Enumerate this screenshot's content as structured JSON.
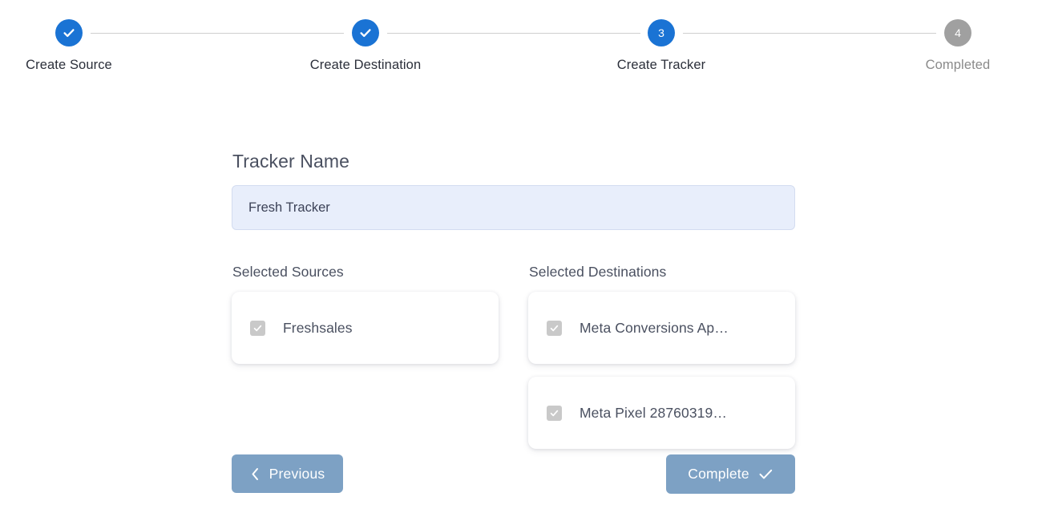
{
  "stepper": {
    "steps": [
      {
        "label": "Create Source",
        "marker": "check",
        "state": "done",
        "center": 86
      },
      {
        "label": "Create Destination",
        "marker": "check",
        "state": "done",
        "center": 456
      },
      {
        "label": "Create Tracker",
        "marker": "3",
        "state": "active",
        "center": 825
      },
      {
        "label": "Completed",
        "marker": "4",
        "state": "todo",
        "center": 1195
      }
    ],
    "accent_color": "#1a73d4",
    "inactive_color": "#a0a0a0",
    "connector_color": "#cfcfcf"
  },
  "form": {
    "tracker_name_label": "Tracker Name",
    "tracker_name_value": "Fresh Tracker",
    "tracker_name_placeholder": "Tracker Name"
  },
  "sources": {
    "title": "Selected Sources",
    "items": [
      {
        "label": "Freshsales",
        "checked": true
      }
    ]
  },
  "destinations": {
    "title": "Selected Destinations",
    "items": [
      {
        "label": "Meta Conversions Ap…",
        "checked": true
      },
      {
        "label": "Meta Pixel 28760319…",
        "checked": true
      }
    ]
  },
  "footer": {
    "previous_label": "Previous",
    "complete_label": "Complete",
    "button_color": "#7da1c4",
    "previous_icon": "chevron-left-icon",
    "complete_icon": "check-icon"
  }
}
